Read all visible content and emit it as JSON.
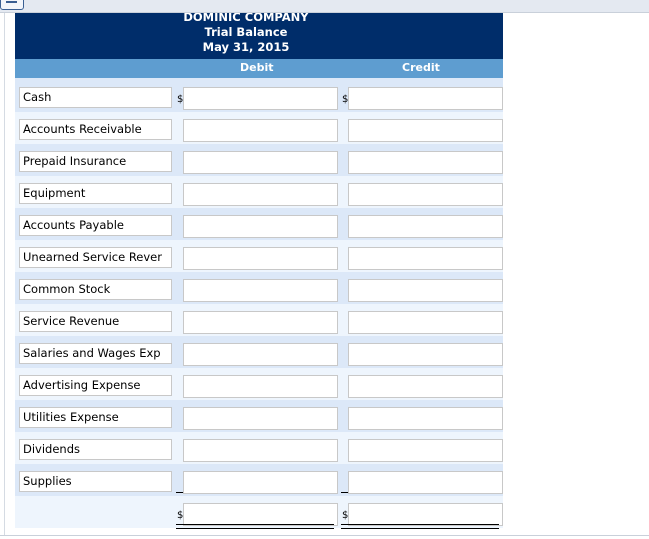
{
  "header": {
    "company": "DOMINIC COMPANY",
    "statement": "Trial Balance",
    "date": "May 31, 2015"
  },
  "columns": {
    "debit": "Debit",
    "credit": "Credit"
  },
  "currency_symbol": "$",
  "rows": [
    {
      "account": "Cash",
      "debit": "",
      "credit": ""
    },
    {
      "account": "Accounts Receivable",
      "debit": "",
      "credit": ""
    },
    {
      "account": "Prepaid Insurance",
      "debit": "",
      "credit": ""
    },
    {
      "account": "Equipment",
      "debit": "",
      "credit": ""
    },
    {
      "account": "Accounts Payable",
      "debit": "",
      "credit": ""
    },
    {
      "account": "Unearned Service Rever",
      "debit": "",
      "credit": ""
    },
    {
      "account": "Common Stock",
      "debit": "",
      "credit": ""
    },
    {
      "account": "Service Revenue",
      "debit": "",
      "credit": ""
    },
    {
      "account": "Salaries and Wages Exp",
      "debit": "",
      "credit": ""
    },
    {
      "account": "Advertising Expense",
      "debit": "",
      "credit": ""
    },
    {
      "account": "Utilities Expense",
      "debit": "",
      "credit": ""
    },
    {
      "account": "Dividends",
      "debit": "",
      "credit": ""
    },
    {
      "account": "Supplies",
      "debit": "",
      "credit": ""
    }
  ],
  "totals": {
    "debit": "",
    "credit": ""
  },
  "colors": {
    "header_bg": "#002d6a",
    "column_header_bg": "#5e9dd0",
    "row_dark": "#dce8f8",
    "row_light": "#eef5fd"
  }
}
